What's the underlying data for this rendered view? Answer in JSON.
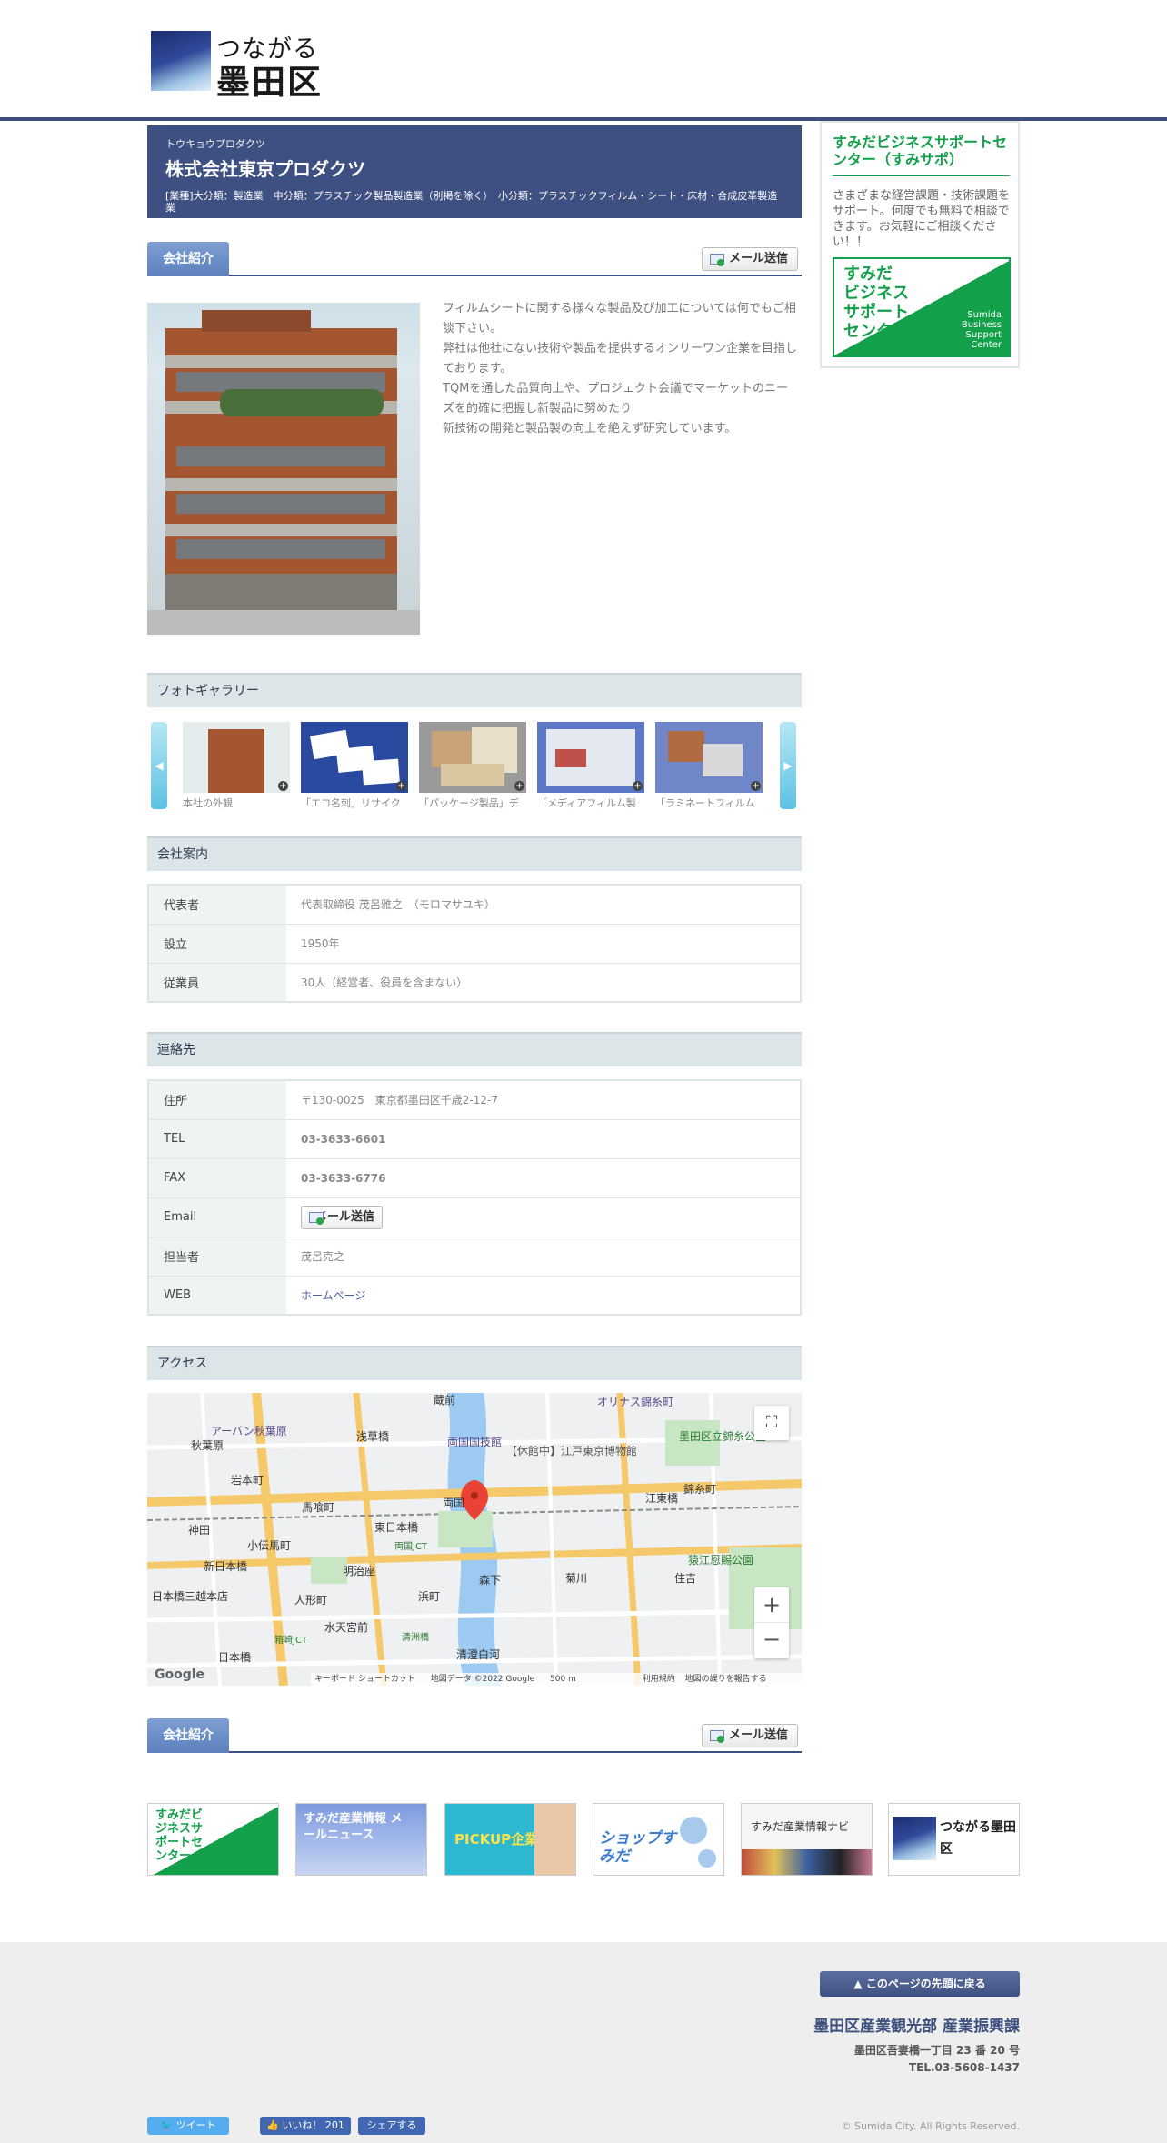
{
  "header": {
    "logo_line1": "つながる",
    "logo_line2": "墨田区"
  },
  "company": {
    "kana": "トウキョウプロダクツ",
    "name": "株式会社東京プロダクツ",
    "category": "[業種]大分類：製造業　中分類：プラスチック製品製造業（別掲を除く）　小分類：プラスチックフィルム・シート・床材・合成皮革製造業"
  },
  "intro": {
    "tab": "会社紹介",
    "mail_button": "メール送信",
    "description": [
      "フィルムシートに関する様々な製品及び加工については何でもご相談下さい。",
      "弊社は他社にない技術や製品を提供するオンリーワン企業を目指しております。",
      "TQMを通した品質向上や、プロジェクト会議でマーケットのニーズを的確に把握し新製品に努めたり",
      "新技術の開発と製品製の向上を絶えず研究しています。"
    ]
  },
  "gallery": {
    "title": "フォトギャラリー",
    "items": [
      {
        "caption": "本社の外観"
      },
      {
        "caption": "「エコ名刺」リサイク"
      },
      {
        "caption": "「パッケージ製品」デ"
      },
      {
        "caption": "「メディアフィルム製"
      },
      {
        "caption": "「ラミネートフィルム"
      }
    ]
  },
  "profile": {
    "title": "会社案内",
    "rows": [
      {
        "label": "代表者",
        "value": "代表取締役 茂呂雅之　（モロマサユキ）"
      },
      {
        "label": "設立",
        "value": "1950年"
      },
      {
        "label": "従業員",
        "value": "30人（経営者、役員を含まない）"
      }
    ]
  },
  "contact": {
    "title": "連絡先",
    "address_label": "住所",
    "address": "〒130-0025　東京都墨田区千歳2-12-7",
    "tel_label": "TEL",
    "tel": "03-3633-6601",
    "fax_label": "FAX",
    "fax": "03-3633-6776",
    "email_label": "Email",
    "email_button": "メール送信",
    "person_label": "担当者",
    "person": "茂呂克之",
    "web_label": "WEB",
    "web": "ホームページ"
  },
  "access": {
    "title": "アクセス",
    "map_labels": [
      "両国国技館",
      "【休館中】江戸東京博物館",
      "墨田区立錦糸公園",
      "浅草橋",
      "秋葉原",
      "錦糸町",
      "江東橋",
      "猿江恩賜公園",
      "菊川",
      "森下",
      "住吉",
      "両国",
      "東日本橋",
      "馬喰町",
      "小伝馬町",
      "人形町",
      "水天宮前",
      "明治座",
      "浜町",
      "蔵前",
      "オリナス錦糸町",
      "アーバン秋葉原",
      "岩本町",
      "神田",
      "新日本橋",
      "日本橋三越本店",
      "日本橋",
      "清澄白河",
      "両国JCT",
      "箱崎JCT",
      "清洲橋"
    ],
    "map_footer": [
      "キーボード ショートカット",
      "地図データ ©2022 Google",
      "500 m",
      "利用規約",
      "地図の誤りを報告する"
    ],
    "zoom_in": "+",
    "zoom_out": "−",
    "fullscreen": "⛶",
    "google": "Google"
  },
  "sidebar": {
    "title": "すみだビジネスサポートセンター（すみサポ）",
    "text": "さまざまな経営課題・技術課題をサポート。何度でも無料で相談できます。お気軽にご相談ください！！",
    "banner_title": "すみだ\nビジネス\nサポート\nセンター",
    "banner_en": "Sumida\nBusiness\nSupport\nCenter"
  },
  "banners": [
    {
      "label": "すみだビジネスサポートセンター"
    },
    {
      "label": "すみだ産業情報 メールニュース"
    },
    {
      "label": "PICKUP企業"
    },
    {
      "label": "ショップすみだ"
    },
    {
      "label": "すみだ産業情報ナビ"
    },
    {
      "label": "つながる墨田区"
    }
  ],
  "footer": {
    "back_to_top": "このページの先頭に戻る",
    "department": "墨田区産業観光部 産業振興課",
    "address": "墨田区吾妻橋一丁目 23 番 20 号",
    "tel": "TEL.03-5608-1437",
    "tweet": "ツイート",
    "like": "いいね！ 201",
    "share": "シェアする",
    "copyright": "© Sumida City. All Rights Reserved."
  },
  "colors": {
    "navy": "#3e4f82",
    "green": "#13a04a",
    "tab_blue": "#6b8fc8"
  }
}
